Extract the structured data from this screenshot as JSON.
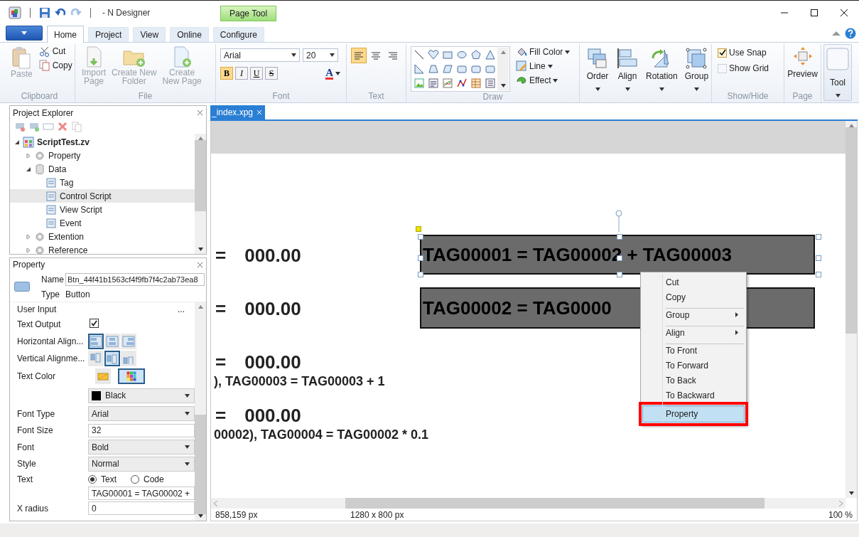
{
  "window": {
    "title": "- N Designer",
    "contextual_tab": "Page Tool"
  },
  "ribbon_tabs": [
    {
      "label": "Home",
      "selected": true
    },
    {
      "label": "Project",
      "selected": false
    },
    {
      "label": "View",
      "selected": false
    },
    {
      "label": "Online",
      "selected": false
    },
    {
      "label": "Configure",
      "selected": false
    }
  ],
  "ribbon": {
    "clipboard": {
      "label": "Clipboard",
      "paste": {
        "label": "Paste",
        "disabled": true
      },
      "cut": "Cut",
      "copy": "Copy"
    },
    "file": {
      "label": "File",
      "buttons": [
        {
          "lines": [
            "Import",
            "Page"
          ],
          "disabled": true
        },
        {
          "lines": [
            "Create New",
            "Folder"
          ],
          "disabled": true
        },
        {
          "lines": [
            "Create",
            "New Page"
          ],
          "disabled": true
        }
      ]
    },
    "font": {
      "label": "Font",
      "family": "Arial",
      "size": "20",
      "styles": [
        {
          "kind": "bold",
          "glyph": "B",
          "selected": true
        },
        {
          "kind": "italic",
          "glyph": "I",
          "selected": false
        },
        {
          "kind": "underline",
          "glyph": "U",
          "selected": false
        },
        {
          "kind": "strike",
          "glyph": "S",
          "selected": false
        }
      ],
      "color_glyph": "A"
    },
    "text": {
      "label": "Text",
      "aligns": [
        {
          "selected": true
        },
        {
          "selected": false
        },
        {
          "selected": false
        }
      ]
    },
    "draw": {
      "label": "Draw",
      "commands": [
        "Fill Color",
        "Line",
        "Effect"
      ]
    },
    "arrange": {
      "buttons": [
        "Order",
        "Align",
        "Rotation",
        "Group"
      ]
    },
    "show_hide": {
      "label": "Show/Hide",
      "options": [
        {
          "label": "Use Snap",
          "checked": true
        },
        {
          "label": "Show Grid",
          "checked": false
        }
      ]
    },
    "page": {
      "label": "Page",
      "button": "Preview"
    },
    "tool": {
      "button": "Tool"
    }
  },
  "explorer": {
    "title": "Project Explorer",
    "tree": [
      {
        "label": "ScriptTest.zv",
        "expanded": true,
        "selected": false,
        "children": [
          {
            "label": "Property",
            "expanded": false,
            "selected": false
          },
          {
            "label": "Data",
            "expanded": true,
            "selected": false,
            "children": [
              {
                "label": "Tag",
                "selected": false
              },
              {
                "label": "Control Script",
                "selected": true
              },
              {
                "label": "View Script",
                "selected": false
              },
              {
                "label": "Event",
                "selected": false
              }
            ]
          },
          {
            "label": "Extention",
            "expanded": false,
            "selected": false
          },
          {
            "label": "Reference",
            "expanded": false,
            "selected": false
          }
        ]
      }
    ]
  },
  "property": {
    "title": "Property",
    "name_label": "Name",
    "name_value": "Btn_44f41b1563cf4f9fb7f4c2ab73ea8",
    "type_label": "Type",
    "type_value": "Button",
    "rows": [
      {
        "kind": "more",
        "label": "User Input",
        "value": "..."
      },
      {
        "kind": "checkbox",
        "label": "Text Output",
        "checked": true
      },
      {
        "kind": "halign",
        "label": "Horizontal Align...",
        "options": [
          {
            "selected": true
          },
          {
            "selected": false
          },
          {
            "selected": false
          }
        ]
      },
      {
        "kind": "valign",
        "label": "Vertical Alignme...",
        "options": [
          {
            "selected": false
          },
          {
            "selected": true
          },
          {
            "selected": false
          }
        ]
      },
      {
        "kind": "colorpick",
        "label": "Text Color",
        "options": [
          {
            "selected": false
          },
          {
            "selected": true
          }
        ]
      },
      {
        "kind": "color",
        "color": "#000000",
        "value": "Black"
      },
      {
        "kind": "select",
        "label": "Font Type",
        "value": "Arial"
      },
      {
        "kind": "input",
        "label": "Font Size",
        "value": "32"
      },
      {
        "kind": "select",
        "label": "Font",
        "value": "Bold"
      },
      {
        "kind": "select",
        "label": "Style",
        "value": "Normal"
      },
      {
        "kind": "radio",
        "label": "Text",
        "options": [
          {
            "label": "Text",
            "selected": true
          },
          {
            "label": "Code",
            "selected": false
          }
        ]
      },
      {
        "kind": "input",
        "value": "TAG00001 = TAG00002 +"
      },
      {
        "kind": "input",
        "label": "X radius",
        "value": "0"
      }
    ]
  },
  "document": {
    "tab": "_index.xpg",
    "readings": [
      {
        "sign": "=",
        "value": "000.00"
      },
      {
        "sign": "=",
        "value": "000.00"
      },
      {
        "sign": "=",
        "value": "000.00"
      },
      {
        "sign": "=",
        "value": "000.00"
      }
    ],
    "formulas": [
      "), TAG00003 = TAG00003 + 1",
      "00002), TAG00004 = TAG00002 * 0.1"
    ],
    "buttons": [
      {
        "label": "TAG00001 = TAG00002 + TAG00003",
        "selected": true
      },
      {
        "label": "TAG00002 = TAG0000",
        "selected": false
      }
    ],
    "context_menu": [
      {
        "label": "Cut",
        "submenu": false,
        "separator_before": false,
        "selected": false
      },
      {
        "label": "Copy",
        "submenu": false,
        "separator_before": false,
        "selected": false
      },
      {
        "label": "Group",
        "submenu": true,
        "separator_before": true,
        "selected": false
      },
      {
        "label": "Align",
        "submenu": true,
        "separator_before": true,
        "selected": false
      },
      {
        "label": "To Front",
        "submenu": false,
        "separator_before": true,
        "selected": false
      },
      {
        "label": "To Forward",
        "submenu": false,
        "separator_before": false,
        "selected": false
      },
      {
        "label": "To Back",
        "submenu": false,
        "separator_before": false,
        "selected": false
      },
      {
        "label": "To Backward",
        "submenu": false,
        "separator_before": false,
        "selected": false
      },
      {
        "label": "Property",
        "submenu": false,
        "separator_before": true,
        "selected": true
      }
    ],
    "status": {
      "cursor": "858,159 px",
      "size": "1280 x 800 px",
      "zoom": "100 %"
    }
  }
}
